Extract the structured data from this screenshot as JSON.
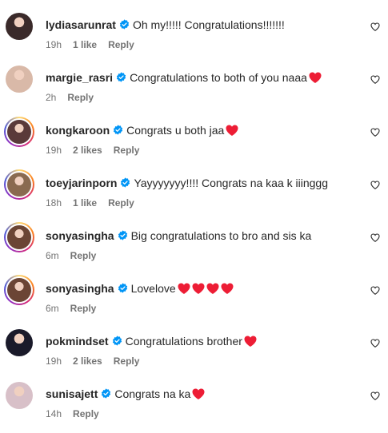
{
  "comments": [
    {
      "username": "lydiasarunrat",
      "verified": true,
      "text": "Oh my!!!!! Congratulations!!!!!!!",
      "hearts": 0,
      "time": "19h",
      "likes": "1 like",
      "reply": "Reply",
      "story_ring": false,
      "avatar_color": "#3a2a2a"
    },
    {
      "username": "margie_rasri",
      "verified": true,
      "text": "Congratulations to both of you naaa",
      "hearts": 1,
      "time": "2h",
      "likes": "",
      "reply": "Reply",
      "story_ring": false,
      "avatar_color": "#d9b9a8"
    },
    {
      "username": "kongkaroon",
      "verified": true,
      "text": "Congrats u both jaa",
      "hearts": 1,
      "time": "19h",
      "likes": "2 likes",
      "reply": "Reply",
      "story_ring": true,
      "avatar_color": "#5a3a3a"
    },
    {
      "username": "toeyjarinporn",
      "verified": true,
      "text": "Yayyyyyyy!!!! Congrats na kaa k iiinggg",
      "hearts": 0,
      "time": "18h",
      "likes": "1 like",
      "reply": "Reply",
      "story_ring": true,
      "avatar_color": "#8a6a50"
    },
    {
      "username": "sonyasingha",
      "verified": true,
      "text": "Big congratulations to bro and sis ka",
      "hearts": 0,
      "time": "6m",
      "likes": "",
      "reply": "Reply",
      "story_ring": true,
      "avatar_color": "#6b4535"
    },
    {
      "username": "sonyasingha",
      "verified": true,
      "text": "Lovelove",
      "hearts": 4,
      "time": "6m",
      "likes": "",
      "reply": "Reply",
      "story_ring": true,
      "avatar_color": "#6b4535"
    },
    {
      "username": "pokmindset",
      "verified": true,
      "text": "Congratulations brother",
      "hearts": 1,
      "time": "19h",
      "likes": "2 likes",
      "reply": "Reply",
      "story_ring": false,
      "avatar_color": "#1a1a2a"
    },
    {
      "username": "sunisajett",
      "verified": true,
      "text": "Congrats na ka",
      "hearts": 1,
      "time": "14h",
      "likes": "",
      "reply": "Reply",
      "story_ring": false,
      "avatar_color": "#d8c0c8"
    }
  ],
  "colors": {
    "heart": "#ed1d35",
    "verified": "#0095f6",
    "meta": "#737373"
  },
  "icons": {
    "verified": "verified-badge-icon",
    "heart": "heart-emoji-icon",
    "like": "heart-outline-icon"
  }
}
